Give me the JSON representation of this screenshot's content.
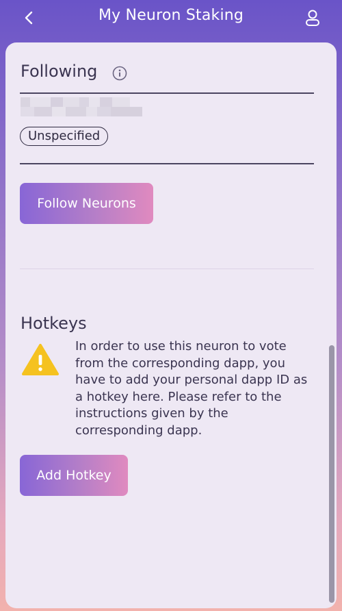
{
  "header": {
    "title": "My Neuron Staking",
    "back_icon": "chevron-left-icon",
    "account_icon": "user-icon"
  },
  "following": {
    "title": "Following",
    "info_icon": "info-icon",
    "status_pill": "Unspecified",
    "follow_button": "Follow Neurons"
  },
  "hotkeys": {
    "title": "Hotkeys",
    "warning_icon": "warning-icon",
    "warning_text": "In order to use this neuron to vote from the corresponding dapp, you have to add your personal dapp ID as a hotkey here. Please refer to the instructions given by the corresponding dapp.",
    "add_button": "Add Hotkey"
  },
  "colors": {
    "accent_start": "#8866d6",
    "accent_end": "#e08abf",
    "card_bg": "#eee8f4",
    "warning": "#f5c220"
  }
}
